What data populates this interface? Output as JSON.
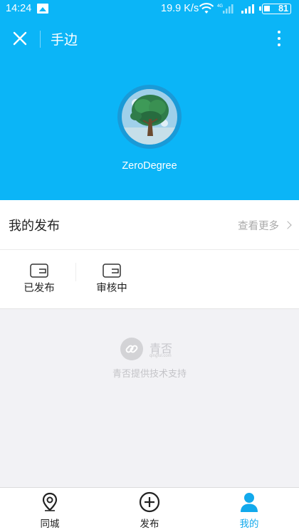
{
  "status_bar": {
    "time": "14:24",
    "network_speed": "19.9 K/s",
    "battery": "81"
  },
  "nav": {
    "title": "手边"
  },
  "profile": {
    "username": "ZeroDegree"
  },
  "my_posts": {
    "title": "我的发布",
    "more_label": "查看更多",
    "items": [
      {
        "label": "已发布"
      },
      {
        "label": "审核中"
      }
    ]
  },
  "footer": {
    "brand": "青否",
    "brand_url": "qingful.com",
    "tagline": "青否提供技术支持"
  },
  "tabbar": {
    "tabs": [
      {
        "label": "同城",
        "icon": "location-pin-icon"
      },
      {
        "label": "发布",
        "icon": "plus-circle-icon"
      },
      {
        "label": "我的",
        "icon": "user-icon",
        "active": true
      }
    ]
  },
  "colors": {
    "primary": "#0bb5f7",
    "active_tab": "#12a9ec",
    "background": "#f2f2f5"
  }
}
